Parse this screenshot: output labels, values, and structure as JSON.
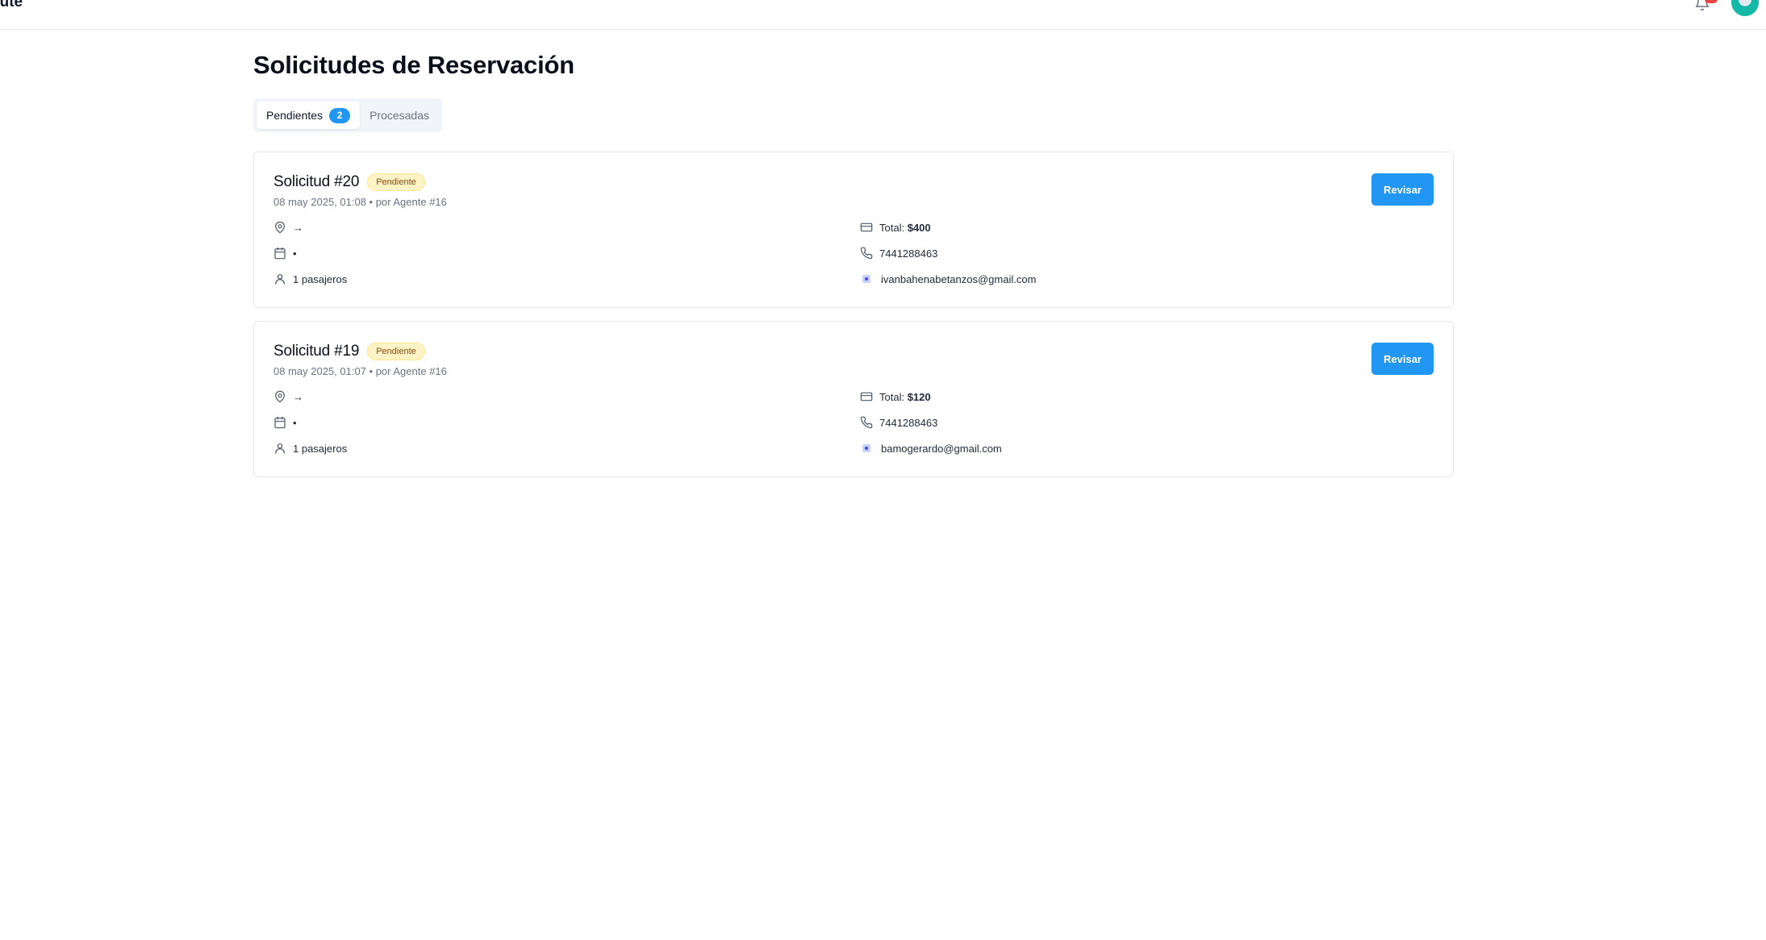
{
  "header": {
    "brand": "oute"
  },
  "page": {
    "title": "Solicitudes de Reservación"
  },
  "tabs": [
    {
      "label": "Pendientes",
      "count": "2",
      "active": true
    },
    {
      "label": "Procesadas",
      "active": false
    }
  ],
  "requests": [
    {
      "title": "Solicitud #20",
      "status": "Pendiente",
      "meta": "08 may 2025, 01:08 • por Agente #16",
      "route": "→",
      "date": "•",
      "passengers": "1 pasajeros",
      "total_label": "Total:",
      "total_value": "$400",
      "phone": "7441288463",
      "email": "ivanbahenabetanzos@gmail.com",
      "action": "Revisar"
    },
    {
      "title": "Solicitud #19",
      "status": "Pendiente",
      "meta": "08 may 2025, 01:07 • por Agente #16",
      "route": "→",
      "date": "•",
      "passengers": "1 pasajeros",
      "total_label": "Total:",
      "total_value": "$120",
      "phone": "7441288463",
      "email": "bamogerardo@gmail.com",
      "action": "Revisar"
    }
  ],
  "colors": {
    "primary": "#2196f3",
    "badge_bg": "#fef3c7",
    "badge_text": "#854d0e",
    "notification": "#ef4444"
  },
  "icons": {
    "route": "map-pin-icon",
    "date": "calendar-icon",
    "passengers": "user-icon",
    "total": "credit-card-icon",
    "phone": "phone-icon",
    "email": "mail-icon",
    "notifications": "bell-icon"
  }
}
